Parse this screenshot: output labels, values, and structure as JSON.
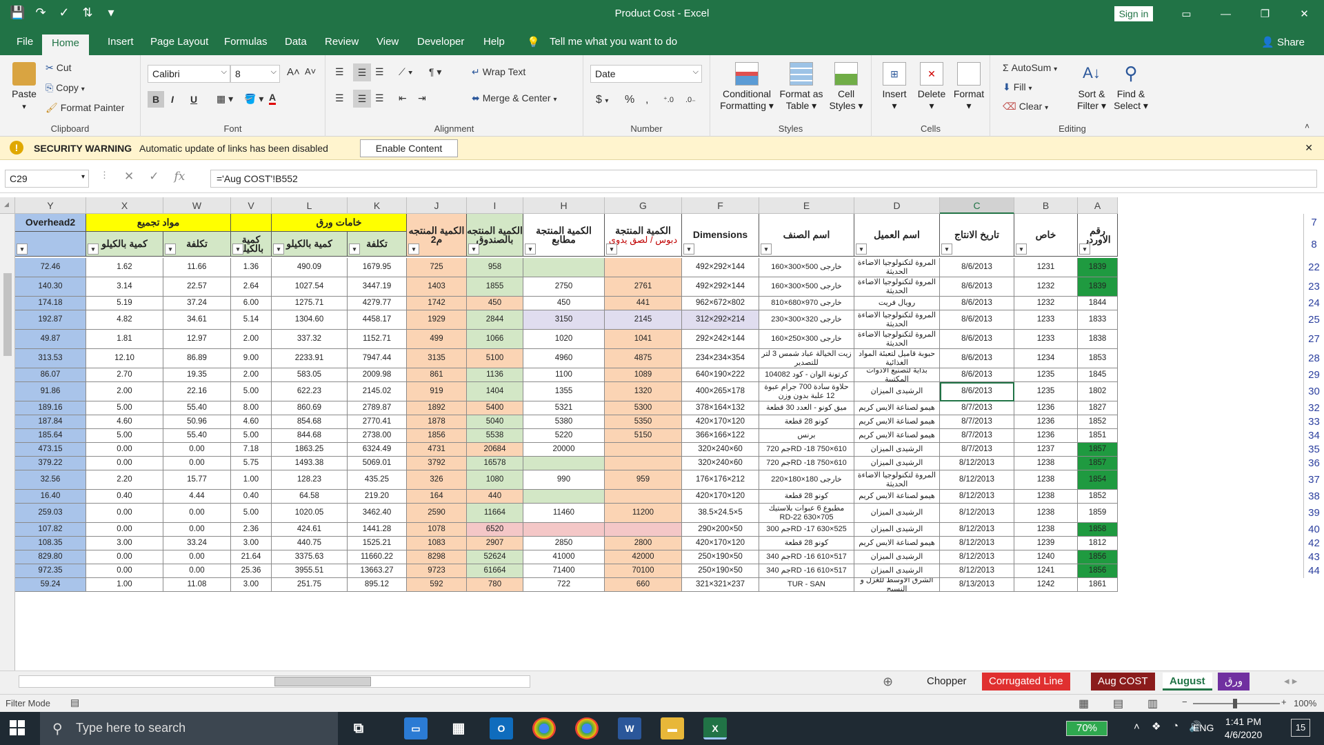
{
  "titlebar": {
    "title": "Product Cost  -  Excel",
    "signin": "Sign in"
  },
  "tabs": [
    "File",
    "Home",
    "Insert",
    "Page Layout",
    "Formulas",
    "Data",
    "Review",
    "View",
    "Developer",
    "Help"
  ],
  "tell_me": "Tell me what you want to do",
  "share": "Share",
  "ribbon": {
    "clipboard": {
      "paste": "Paste",
      "cut": "Cut",
      "copy": "Copy",
      "painter": "Format Painter",
      "label": "Clipboard"
    },
    "font": {
      "name": "Calibri",
      "size": "8",
      "label": "Font",
      "bold": "B",
      "italic": "I",
      "underline": "U"
    },
    "alignment": {
      "wrap": "Wrap Text",
      "merge": "Merge & Center",
      "label": "Alignment"
    },
    "number": {
      "format": "Date",
      "currency": "$",
      "percent": "%",
      "comma": ",",
      "label": "Number"
    },
    "styles": {
      "cond1": "Conditional",
      "cond2": "Formatting",
      "fmt1": "Format as",
      "fmt2": "Table",
      "cell1": "Cell",
      "cell2": "Styles",
      "label": "Styles"
    },
    "cells": {
      "insert": "Insert",
      "delete": "Delete",
      "format": "Format",
      "label": "Cells"
    },
    "editing": {
      "autosum": "AutoSum",
      "fill": "Fill",
      "clear": "Clear",
      "sort1": "Sort &",
      "sort2": "Filter",
      "find1": "Find &",
      "find2": "Select",
      "label": "Editing"
    }
  },
  "security": {
    "title": "SECURITY WARNING",
    "message": "Automatic update of links has been disabled",
    "button": "Enable Content"
  },
  "namebox": "C29",
  "formula": "='Aug COST'!B552",
  "columns": [
    "Y",
    "X",
    "W",
    "V",
    "L",
    "K",
    "J",
    "I",
    "H",
    "G",
    "F",
    "E",
    "D",
    "C",
    "B",
    "A"
  ],
  "row_numbers": [
    "7",
    "8",
    "22",
    "23",
    "24",
    "25",
    "27",
    "28",
    "29",
    "30",
    "32",
    "33",
    "34",
    "35",
    "36",
    "37",
    "38",
    "39",
    "40",
    "42",
    "43",
    "44"
  ],
  "headers": {
    "overhead": "Overhead2",
    "mawad": "مواد تجميع",
    "khamat": "خامات ورق",
    "qty_kg_x": "كمية بالكيلو",
    "cost_w": "تكلفة",
    "qty_kg_v": "كمية بالكيلو",
    "qty_kg_l": "كمية بالكيلو",
    "cost_k": "تكلفة",
    "qty_m2": "الكمية المنتجه م2",
    "qty_box": "الكمية المنتجه بالصندوق",
    "qty_print": "الكمية المنتجة مطابع",
    "qty_g_top": "الكمية المنتجة",
    "qty_g_bot": "دبوس / لصق يدوى",
    "dims": "Dimensions",
    "item": "اسم الصنف",
    "client": "اسم العميل",
    "date": "تاريخ الانتاج",
    "special": "خاص",
    "order": "رقم الاوردر"
  },
  "rows": [
    {
      "y": "72.46",
      "x": "1.62",
      "w": "11.66",
      "v": "1.36",
      "l": "490.09",
      "k": "1679.95",
      "j": "725",
      "i": "958",
      "h": "",
      "g": "",
      "f": "492×292×144",
      "e": "خارجى 500×300×160",
      "d": "المروة لتكنولوجيا الاضاءة الحديثة",
      "c": "8/6/2013",
      "b": "1231",
      "a": "1839",
      "ag": true
    },
    {
      "y": "140.30",
      "x": "3.14",
      "w": "22.57",
      "v": "2.64",
      "l": "1027.54",
      "k": "3447.19",
      "j": "1403",
      "i": "1855",
      "h": "2750",
      "g": "2761",
      "f": "492×292×144",
      "e": "خارجى 500×300×160",
      "d": "المروة لتكنولوجيا الاضاءة الحديثة",
      "c": "8/6/2013",
      "b": "1232",
      "a": "1839",
      "ag": true
    },
    {
      "y": "174.18",
      "x": "5.19",
      "w": "37.24",
      "v": "6.00",
      "l": "1275.71",
      "k": "4279.77",
      "j": "1742",
      "i": "450",
      "h": "450",
      "g": "441",
      "f": "962×672×802",
      "e": "خارجى 970×680×810",
      "d": "رويال فريت",
      "c": "8/6/2013",
      "b": "1232",
      "a": "1844",
      "ag": false
    },
    {
      "y": "192.87",
      "x": "4.82",
      "w": "34.61",
      "v": "5.14",
      "l": "1304.60",
      "k": "4458.17",
      "j": "1929",
      "i": "2844",
      "h": "3150",
      "g": "2145",
      "f": "312×292×214",
      "e": "خارجى 320×300×230",
      "d": "المروة لتكنولوجيا الاضاءة الحديثة",
      "c": "8/6/2013",
      "b": "1233",
      "a": "1833",
      "ag": false
    },
    {
      "y": "49.87",
      "x": "1.81",
      "w": "12.97",
      "v": "2.00",
      "l": "337.32",
      "k": "1152.71",
      "j": "499",
      "i": "1066",
      "h": "1020",
      "g": "1041",
      "f": "292×242×144",
      "e": "خارجى 300×250×160",
      "d": "المروة لتكنولوجيا الاضاءة الحديثة",
      "c": "8/6/2013",
      "b": "1233",
      "a": "1838",
      "ag": false
    },
    {
      "y": "313.53",
      "x": "12.10",
      "w": "86.89",
      "v": "9.00",
      "l": "2233.91",
      "k": "7947.44",
      "j": "3135",
      "i": "5100",
      "h": "4960",
      "g": "4875",
      "f": "234×234×354",
      "e": "زيت الخيالة عباد شمس 3 لتر للتصدير",
      "d": "حبوبة قاميل لتعبئة المواد الغذائية",
      "c": "8/6/2013",
      "b": "1234",
      "a": "1853",
      "ag": false
    },
    {
      "y": "86.07",
      "x": "2.70",
      "w": "19.35",
      "v": "2.00",
      "l": "583.05",
      "k": "2009.98",
      "j": "861",
      "i": "1136",
      "h": "1100",
      "g": "1089",
      "f": "640×190×222",
      "e": "كرتونة الوان - كود 104082",
      "d": "بداية لتصنيع الادوات المكتبية",
      "c": "8/6/2013",
      "b": "1235",
      "a": "1845",
      "ag": false
    },
    {
      "y": "91.86",
      "x": "2.00",
      "w": "22.16",
      "v": "5.00",
      "l": "622.23",
      "k": "2145.02",
      "j": "919",
      "i": "1404",
      "h": "1355",
      "g": "1320",
      "f": "400×265×178",
      "e": "حلاوة سادة 700 جرام عبوة 12 علبة بدون وزن",
      "d": "الرشيدى الميزان",
      "c": "8/6/2013",
      "b": "1235",
      "a": "1802",
      "ag": false
    },
    {
      "y": "189.16",
      "x": "5.00",
      "w": "55.40",
      "v": "8.00",
      "l": "860.69",
      "k": "2789.87",
      "j": "1892",
      "i": "5400",
      "h": "5321",
      "g": "5300",
      "f": "378×164×132",
      "e": "ميق كونو - العدد 30 قطعة",
      "d": "هيمو لصناعة الايس كريم",
      "c": "8/7/2013",
      "b": "1236",
      "a": "1827",
      "ag": false
    },
    {
      "y": "187.84",
      "x": "4.60",
      "w": "50.96",
      "v": "4.60",
      "l": "854.68",
      "k": "2770.41",
      "j": "1878",
      "i": "5040",
      "h": "5380",
      "g": "5350",
      "f": "420×170×120",
      "e": "كونو 28 قطعة",
      "d": "هيمو لصناعة الايس كريم",
      "c": "8/7/2013",
      "b": "1236",
      "a": "1852",
      "ag": false
    },
    {
      "y": "185.64",
      "x": "5.00",
      "w": "55.40",
      "v": "5.00",
      "l": "844.68",
      "k": "2738.00",
      "j": "1856",
      "i": "5538",
      "h": "5220",
      "g": "5150",
      "f": "366×166×122",
      "e": "برنس",
      "d": "هيمو لصناعة الايس كريم",
      "c": "8/7/2013",
      "b": "1236",
      "a": "1851",
      "ag": false
    },
    {
      "y": "473.15",
      "x": "0.00",
      "w": "0.00",
      "v": "7.18",
      "l": "1863.25",
      "k": "6324.49",
      "j": "4731",
      "i": "20684",
      "h": "20000",
      "g": "",
      "f": "320×240×60",
      "e": "RD -18 750×610جم 720",
      "d": "الرشيدى الميزان",
      "c": "8/7/2013",
      "b": "1237",
      "a": "1857",
      "ag": true
    },
    {
      "y": "379.22",
      "x": "0.00",
      "w": "0.00",
      "v": "5.75",
      "l": "1493.38",
      "k": "5069.01",
      "j": "3792",
      "i": "16578",
      "h": "",
      "g": "",
      "f": "320×240×60",
      "e": "RD -18 750×610جم 720",
      "d": "الرشيدى الميزان",
      "c": "8/12/2013",
      "b": "1238",
      "a": "1857",
      "ag": true
    },
    {
      "y": "32.56",
      "x": "2.20",
      "w": "15.77",
      "v": "1.00",
      "l": "128.23",
      "k": "435.25",
      "j": "326",
      "i": "1080",
      "h": "990",
      "g": "959",
      "f": "176×176×212",
      "e": "خارجى 180×180×220",
      "d": "المروة لتكنولوجيا الاضاءة الحديثة",
      "c": "8/12/2013",
      "b": "1238",
      "a": "1854",
      "ag": true
    },
    {
      "y": "16.40",
      "x": "0.40",
      "w": "4.44",
      "v": "0.40",
      "l": "64.58",
      "k": "219.20",
      "j": "164",
      "i": "440",
      "h": "",
      "g": "",
      "f": "420×170×120",
      "e": "كونو 28 قطعة",
      "d": "هيمو لصناعة الايس كريم",
      "c": "8/12/2013",
      "b": "1238",
      "a": "1852",
      "ag": false
    },
    {
      "y": "259.03",
      "x": "0.00",
      "w": "0.00",
      "v": "5.00",
      "l": "1020.05",
      "k": "3462.40",
      "j": "2590",
      "i": "11664",
      "h": "11460",
      "g": "11200",
      "f": "38.5×24.5×5",
      "e": "مطبوع 6 عبوات بلاستيك RD-22 630×705",
      "d": "الرشيدى الميزان",
      "c": "8/12/2013",
      "b": "1238",
      "a": "1859",
      "ag": false
    },
    {
      "y": "107.82",
      "x": "0.00",
      "w": "0.00",
      "v": "2.36",
      "l": "424.61",
      "k": "1441.28",
      "j": "1078",
      "i": "6520",
      "h": "",
      "g": "",
      "f": "290×200×50",
      "e": "RD -17 630×525جم 300",
      "d": "الرشيدى الميزان",
      "c": "8/12/2013",
      "b": "1238",
      "a": "1858",
      "ag": true
    },
    {
      "y": "108.35",
      "x": "3.00",
      "w": "33.24",
      "v": "3.00",
      "l": "440.75",
      "k": "1525.21",
      "j": "1083",
      "i": "2907",
      "h": "2850",
      "g": "2800",
      "f": "420×170×120",
      "e": "كونو 28 قطعة",
      "d": "هيمو لصناعة الايس كريم",
      "c": "8/12/2013",
      "b": "1239",
      "a": "1812",
      "ag": false
    },
    {
      "y": "829.80",
      "x": "0.00",
      "w": "0.00",
      "v": "21.64",
      "l": "3375.63",
      "k": "11660.22",
      "j": "8298",
      "i": "52624",
      "h": "41000",
      "g": "42000",
      "f": "250×190×50",
      "e": "RD -16 610×517جم 340",
      "d": "الرشيدى الميزان",
      "c": "8/12/2013",
      "b": "1240",
      "a": "1856",
      "ag": true
    },
    {
      "y": "972.35",
      "x": "0.00",
      "w": "0.00",
      "v": "25.36",
      "l": "3955.51",
      "k": "13663.27",
      "j": "9723",
      "i": "61664",
      "h": "71400",
      "g": "70100",
      "f": "250×190×50",
      "e": "RD -16 610×517جم 340",
      "d": "الرشيدى الميزان",
      "c": "8/12/2013",
      "b": "1241",
      "a": "1856",
      "ag": true
    },
    {
      "y": "59.24",
      "x": "1.00",
      "w": "11.08",
      "v": "3.00",
      "l": "251.75",
      "k": "895.12",
      "j": "592",
      "i": "780",
      "h": "722",
      "g": "660",
      "f": "321×321×237",
      "e": "TUR - SAN",
      "d": "الشرق الاوسط للغزل و النسيج",
      "c": "8/13/2013",
      "b": "1242",
      "a": "1861",
      "ag": false
    }
  ],
  "sheets": [
    "Chopper",
    "Corrugated Line",
    "Aug COST",
    "August",
    "ورق"
  ],
  "status": {
    "mode": "Filter Mode",
    "zoom": "100%"
  },
  "taskbar": {
    "search": "Type here to search",
    "battery": "70%",
    "lang": "ENG",
    "time": "1:41 PM",
    "date": "4/6/2020",
    "notif": "15"
  },
  "colors": {
    "excel_green": "#217346",
    "blue_cell": "#a9c4ea",
    "green_cell": "#d3e7c6",
    "orange_cell": "#fbd4b4",
    "purple_cell": "#e0ddef",
    "pink_cell": "#f4c7c7",
    "order_green": "#1f9a40",
    "yellow": "#ffff00"
  }
}
